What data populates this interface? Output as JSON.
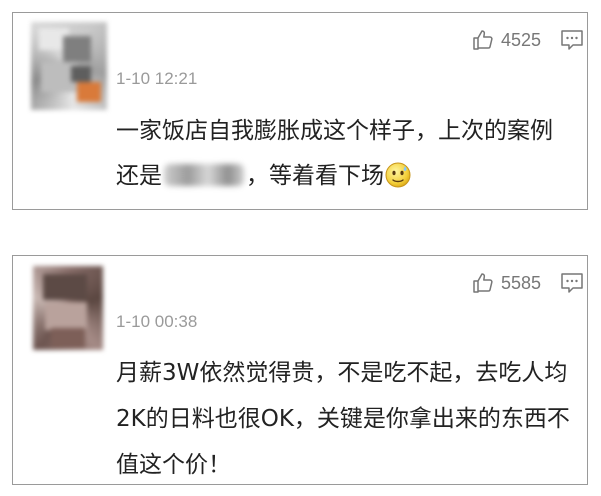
{
  "comments": [
    {
      "likes": "4525",
      "time": "1-10 12:21",
      "text_before": "一家饭店自我膨胀成这个样子，上次的案例还是",
      "redacted": true,
      "text_after": "，等着看下场",
      "emoji_icon": "smiley-sweat-icon"
    },
    {
      "likes": "5585",
      "time": "1-10 00:38",
      "text_before": "月薪3W依然觉得贵，不是吃不起，去吃人均2K的日料也很OK，关键是你拿出来的东西不值这个价！",
      "redacted": false,
      "text_after": "",
      "emoji_icon": ""
    }
  ],
  "icons": {
    "like": "thumbs-up-icon",
    "reply": "comment-bubble-icon"
  },
  "colors": {
    "border": "#9a9a9a",
    "meta": "#9a9a9a",
    "text": "#222222",
    "icon": "#777777"
  }
}
